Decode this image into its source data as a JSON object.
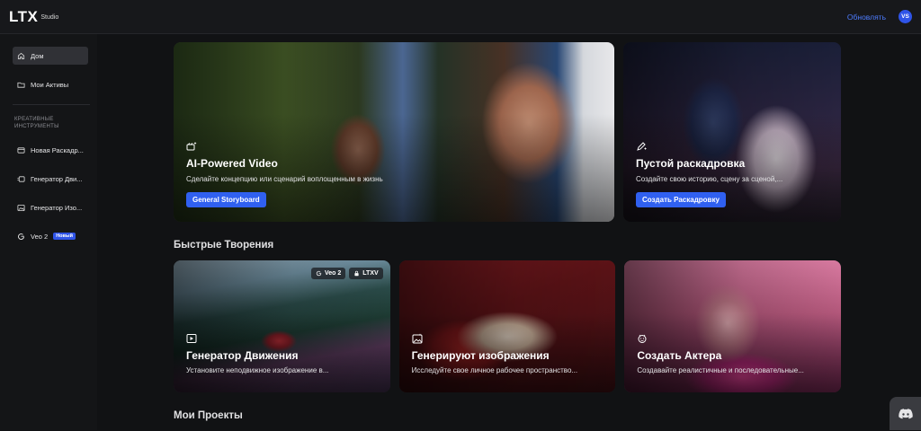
{
  "header": {
    "logo": "LTX",
    "logo_sub": "Studio",
    "upgrade": "Обновлять",
    "avatar_initials": "VS"
  },
  "sidebar": {
    "items": [
      {
        "label": "Дом",
        "icon": "home-icon",
        "active": true
      },
      {
        "label": "Мои Активы",
        "icon": "folder-icon",
        "active": false
      }
    ],
    "section_label": "КРЕАТИВНЫЕ ИНСТРУМЕНТЫ",
    "tools": [
      {
        "label": "Новая Раскадр...",
        "icon": "storyboard-icon"
      },
      {
        "label": "Генератор Дви...",
        "icon": "motion-icon"
      },
      {
        "label": "Генератор Изо...",
        "icon": "image-icon"
      },
      {
        "label": "Veo 2",
        "icon": "google-icon",
        "badge": "Новый"
      }
    ]
  },
  "hero": [
    {
      "title": "AI-Powered Video",
      "description": "Сделайте концепцию или сценарий воплощенным в жизнь",
      "button": "General Storyboard",
      "icon": "video-sparkle-icon"
    },
    {
      "title": "Пустой раскадровка",
      "description": "Создайте свою историю, сцену за сценой,...",
      "button": "Создать Раскадровку",
      "icon": "pen-sparkle-icon"
    }
  ],
  "quick": {
    "title": "Быстрые Творения",
    "cards": [
      {
        "title": "Генератор Движения",
        "description": "Установите неподвижное изображение в...",
        "icon": "motion-card-icon",
        "badges": [
          "Veo 2",
          "LTXV"
        ]
      },
      {
        "title": "Генерируют изображения",
        "description": "Исследуйте свое личное рабочее пространство...",
        "icon": "image-card-icon"
      },
      {
        "title": "Создать Актера",
        "description": "Создавайте реалистичные и последовательные...",
        "icon": "actor-card-icon"
      }
    ]
  },
  "projects": {
    "title": "Мои Проекты"
  },
  "colors": {
    "accent": "#3060f0",
    "link": "#4d7cff",
    "background": "#111214"
  }
}
